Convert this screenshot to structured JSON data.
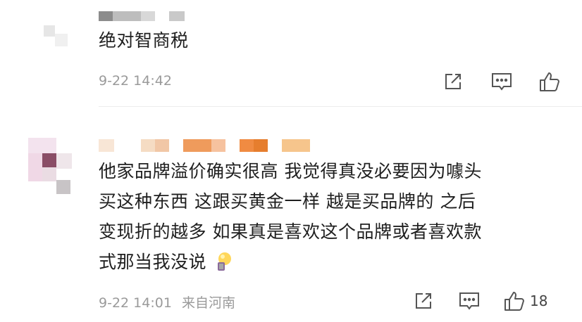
{
  "comments": [
    {
      "text": "绝对智商税",
      "time": "9-22 14:42",
      "location": ""
    },
    {
      "lines": [
        "他家品牌溢价确实很高 我觉得真没必要因为噱头",
        "买这种东西 这跟买黄金一样 越是买品牌的 之后",
        "变现折的越多 如果真是喜欢这个品牌或者喜欢款",
        "式那当我没说"
      ],
      "emoji": "lightbulb-icon",
      "time": "9-22 14:01",
      "location": "来自河南",
      "likes": "18"
    }
  ],
  "icons": {
    "share": "share-icon",
    "reply": "comment-icon",
    "like": "thumbs-up-icon"
  },
  "colors": {
    "meta_text": "#9a9a9a",
    "icon": "#555555"
  }
}
